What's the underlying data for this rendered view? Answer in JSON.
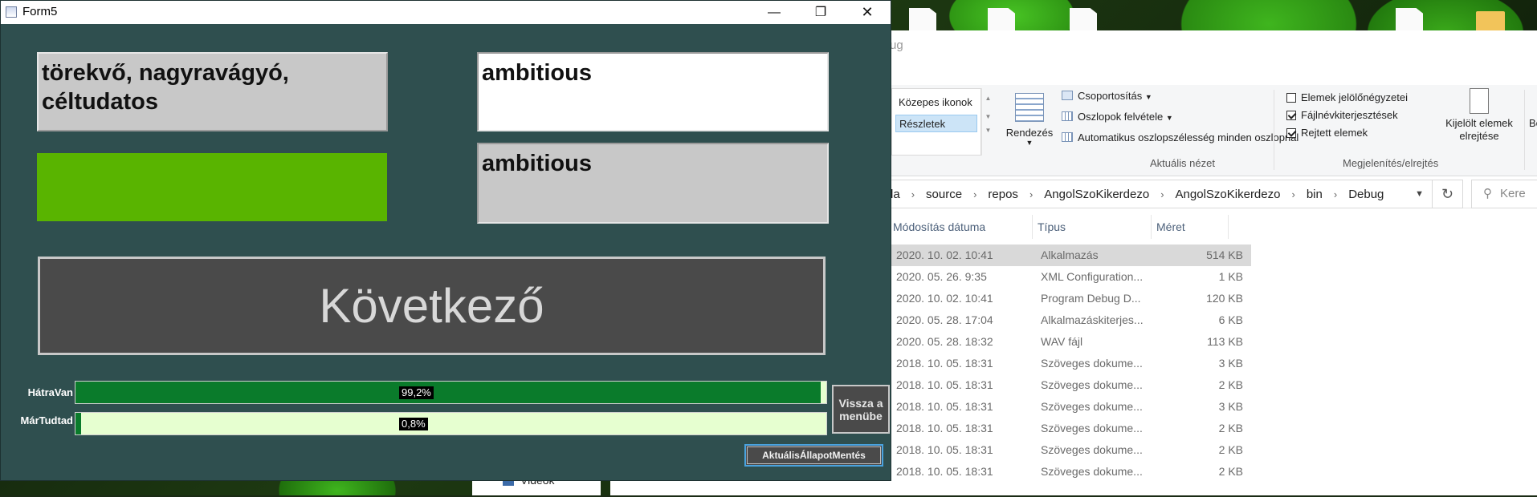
{
  "form": {
    "title": "Form5",
    "minimize": "—",
    "maximize": "❐",
    "close": "✕",
    "hungarian_word": "törekvő, nagyravágyó, céltudatos",
    "answer_input": "ambitious",
    "answer_display": "ambitious",
    "status_color": "#59b400",
    "next_button": "Következő",
    "progress": [
      {
        "label": "HátraVan",
        "text": "99,2%",
        "value": 0.992
      },
      {
        "label": "MárTudtad",
        "text": "0,8%",
        "value": 0.008
      }
    ],
    "back_button": "Vissza a menübe",
    "save_button": "AktuálisÁllapotMentés"
  },
  "explorer": {
    "addr_fragment": "ug",
    "ribbon": {
      "layout_options": [
        "Közepes ikonok",
        "Részletek"
      ],
      "selected_layout": "Részletek",
      "sort_label": "Rendezés",
      "group_by": "Csoportosítás",
      "add_columns": "Oszlopok felvétele",
      "fit_columns": "Automatikus oszlopszélesség minden oszlopnál",
      "current_view_group": "Aktuális nézet",
      "checkboxes": [
        {
          "label": "Elemek jelölőnégyzetei",
          "checked": false
        },
        {
          "label": "Fájlnévkiterjesztések",
          "checked": true
        },
        {
          "label": "Rejtett elemek",
          "checked": true
        }
      ],
      "hide_selected": "Kijelölt elemek elrejtése",
      "showhide_group": "Megjelenítés/elrejtés",
      "be_fragment": "Be"
    },
    "breadcrumbs": [
      "la",
      "source",
      "repos",
      "AngolSzoKikerdezo",
      "AngolSzoKikerdezo",
      "bin",
      "Debug"
    ],
    "search_placeholder": "Kere",
    "columns": [
      "Módosítás dátuma",
      "Típus",
      "Méret"
    ],
    "files": [
      {
        "date": "2020. 10. 02. 10:41",
        "type": "Alkalmazás",
        "size": "514 KB",
        "selected": true
      },
      {
        "date": "2020. 05. 26. 9:35",
        "type": "XML Configuration...",
        "size": "1 KB"
      },
      {
        "date": "2020. 10. 02. 10:41",
        "type": "Program Debug D...",
        "size": "120 KB"
      },
      {
        "date": "2020. 05. 28. 17:04",
        "type": "Alkalmazáskiterjes...",
        "size": "6 KB"
      },
      {
        "date": "2020. 05. 28. 18:32",
        "type": "WAV fájl",
        "size": "113 KB"
      },
      {
        "date": "2018. 10. 05. 18:31",
        "type": "Szöveges dokume...",
        "size": "3 KB"
      },
      {
        "date": "2018. 10. 05. 18:31",
        "type": "Szöveges dokume...",
        "size": "2 KB"
      },
      {
        "date": "2018. 10. 05. 18:31",
        "type": "Szöveges dokume...",
        "size": "3 KB"
      },
      {
        "date": "2018. 10. 05. 18:31",
        "type": "Szöveges dokume...",
        "size": "2 KB"
      },
      {
        "date": "2018. 10. 05. 18:31",
        "type": "Szöveges dokume...",
        "size": "2 KB"
      },
      {
        "date": "2018. 10. 05. 18:31",
        "type": "Szöveges dokume...",
        "size": "2 KB"
      }
    ],
    "nav_item": "Videók"
  }
}
